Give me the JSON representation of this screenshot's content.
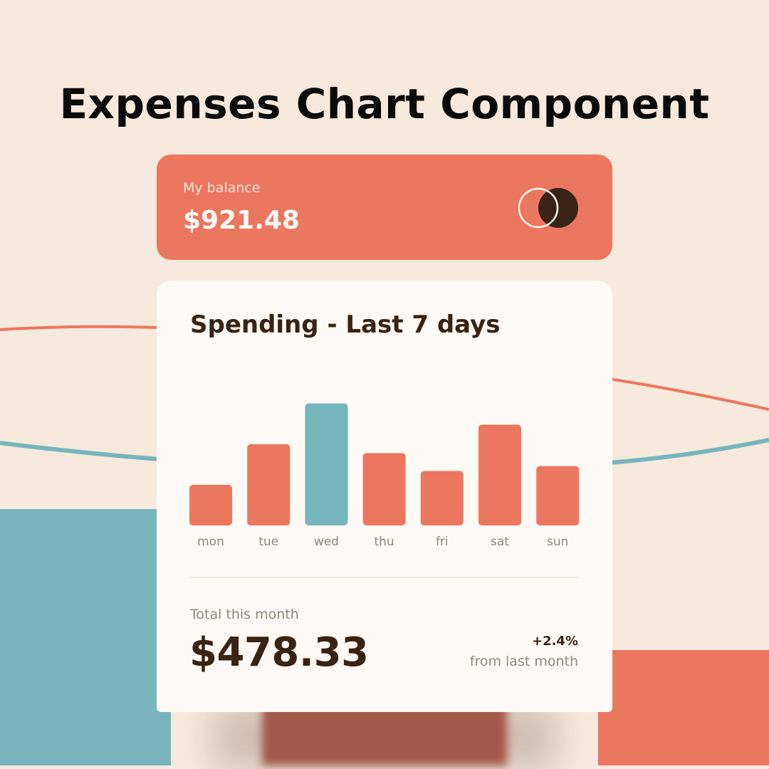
{
  "page": {
    "title": "Expenses Chart Component"
  },
  "balance": {
    "label": "My balance",
    "amount": "$921.48",
    "logo_icon": "two-circles-logo-icon"
  },
  "spending": {
    "title": "Spending - Last 7 days",
    "total_label": "Total this month",
    "total_amount": "$478.33",
    "change": "+2.4%",
    "change_label": "from last month"
  },
  "colors": {
    "accent": "#ec775f",
    "highlight": "#76b5bc",
    "dark": "#382314",
    "background": "#f6e9dd",
    "card": "#fffaf5"
  },
  "chart_data": {
    "type": "bar",
    "categories": [
      "mon",
      "tue",
      "wed",
      "thu",
      "fri",
      "sat",
      "sun"
    ],
    "values": [
      17.45,
      34.91,
      52.36,
      31.07,
      23.39,
      43.28,
      25.48
    ],
    "highlight_category": "wed",
    "ylim": [
      0,
      55
    ],
    "grid": false
  }
}
